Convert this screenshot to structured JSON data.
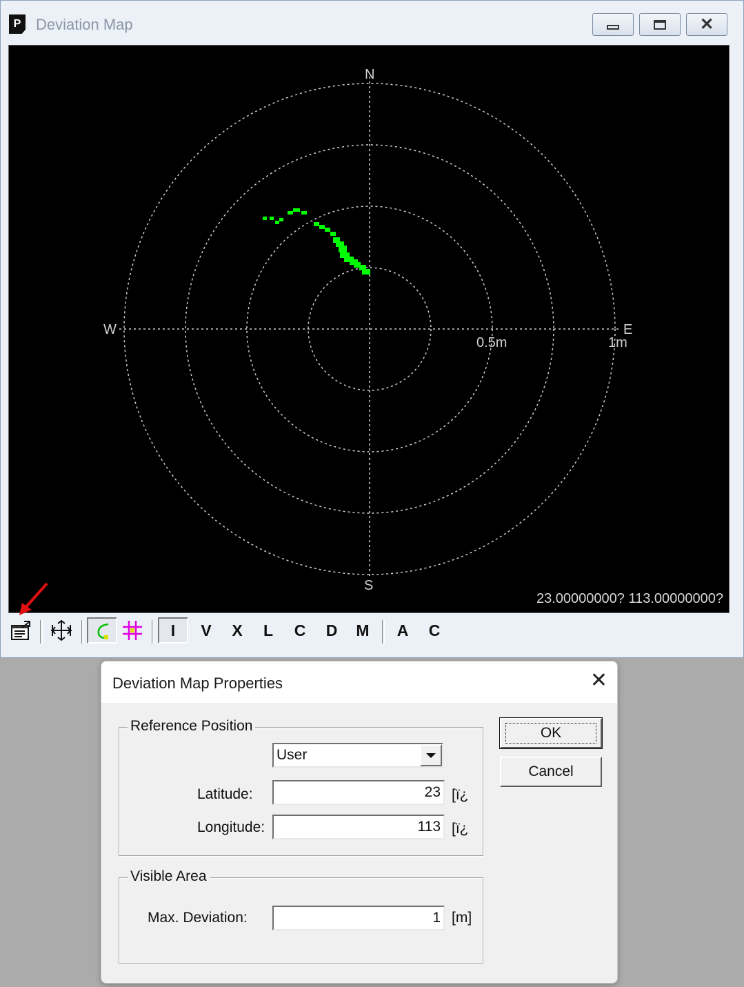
{
  "window": {
    "title": "Deviation Map",
    "minimize_icon": "minimize-icon",
    "maximize_icon": "maximize-icon",
    "close_icon": "close-icon"
  },
  "map": {
    "compass": {
      "north": "N",
      "south": "S",
      "east": "E",
      "west": "W"
    },
    "scale_labels": {
      "half": "0.5m",
      "one": "1m"
    },
    "coordinates_readout": "23.00000000? 113.00000000?",
    "track_color": "#00ff00"
  },
  "toolbar": {
    "properties_icon": "properties-icon",
    "fit_icon": "fit-view-icon",
    "track_icon": "track-icon",
    "grid_icon": "grid-icon",
    "letters": [
      "I",
      "V",
      "X",
      "L",
      "C",
      "D",
      "M",
      "A",
      "C"
    ]
  },
  "dialog": {
    "title": "Deviation Map Properties",
    "reference_group": "Reference Position",
    "reference_mode": "User",
    "latitude_label": "Latitude:",
    "latitude_value": "23",
    "latitude_unit": "[ï¿",
    "longitude_label": "Longitude:",
    "longitude_value": "113",
    "longitude_unit": "[ï¿",
    "visible_group": "Visible Area",
    "max_dev_label": "Max. Deviation:",
    "max_dev_value": "1",
    "max_dev_unit": "[m]",
    "ok_label": "OK",
    "cancel_label": "Cancel"
  }
}
